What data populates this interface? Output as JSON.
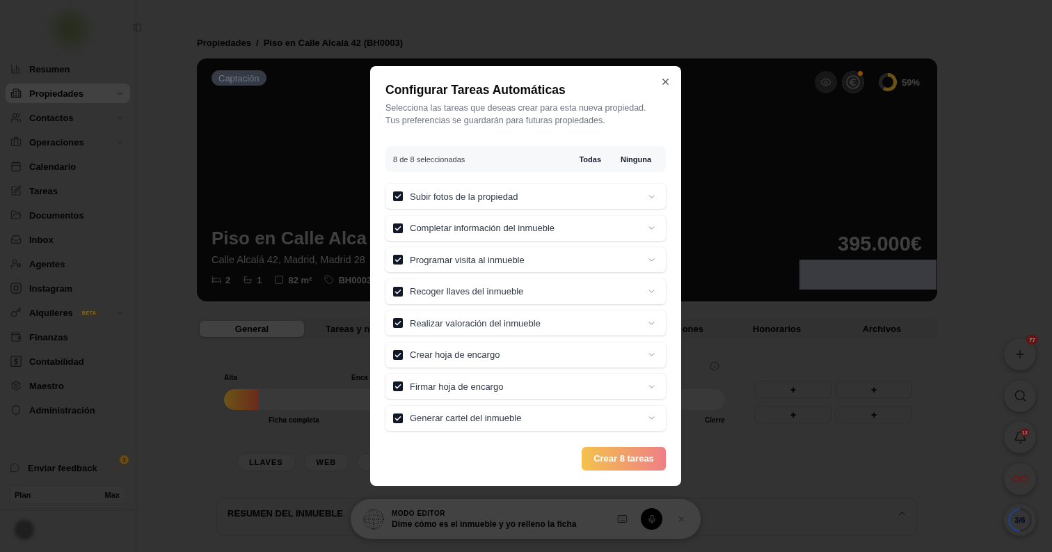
{
  "sidebar": {
    "items": [
      {
        "label": "Resumen",
        "kind": "link",
        "selected": false
      },
      {
        "label": "Propiedades",
        "kind": "group",
        "selected": true
      },
      {
        "label": "Contactos",
        "kind": "group",
        "selected": false
      },
      {
        "label": "Operaciones",
        "kind": "group",
        "selected": false
      },
      {
        "label": "Calendario",
        "kind": "link",
        "selected": false
      },
      {
        "label": "Tareas",
        "kind": "link",
        "selected": false
      },
      {
        "label": "Documentos",
        "kind": "link",
        "selected": false
      },
      {
        "label": "Inbox",
        "kind": "link",
        "selected": false
      },
      {
        "label": "Agentes",
        "kind": "link",
        "selected": false
      },
      {
        "label": "Instagram",
        "kind": "link",
        "selected": false
      },
      {
        "label": "Alquileres",
        "kind": "group",
        "badge": "BETA",
        "selected": false
      },
      {
        "label": "Finanzas",
        "kind": "link",
        "selected": false
      },
      {
        "label": "Contabilidad",
        "kind": "link",
        "selected": false
      },
      {
        "label": "Maestro",
        "kind": "link",
        "selected": false
      },
      {
        "label": "Administración",
        "kind": "link",
        "selected": false
      }
    ],
    "feedback": {
      "label": "Enviar feedback",
      "alert_count": "1"
    },
    "plan": {
      "label": "Plan",
      "value": "Max"
    }
  },
  "breadcrumb": {
    "items": [
      "Propiedades",
      "Piso en Calle Alcalá 42 (BH0003)"
    ],
    "separator": "/"
  },
  "property": {
    "status": "Captación",
    "billing_notification": true,
    "completion": {
      "level": 0.59,
      "reading": "59%"
    },
    "title": "Piso en Calle Alca",
    "address": "Calle Alcalá 42, Madrid, Madrid 28",
    "features": [
      {
        "kind": "bedrooms",
        "value": "2"
      },
      {
        "kind": "bathrooms",
        "value": "1"
      },
      {
        "kind": "area",
        "value": "82 m²"
      },
      {
        "kind": "reference",
        "value": "BH0003"
      }
    ],
    "price": "395.000€"
  },
  "tabs": [
    {
      "label": "General",
      "selected": true
    },
    {
      "label": "Tareas y n",
      "selected": false
    },
    {
      "label": "ones",
      "selected": false
    },
    {
      "label": "Honorarios",
      "selected": false
    },
    {
      "label": "Archivos",
      "selected": false
    }
  ],
  "pipeline": {
    "top_labels": [
      "Alta",
      "Enca"
    ],
    "bottom_labels": [
      "Ficha completa",
      "Cierre"
    ],
    "level": 0.07,
    "add_buttons": [
      "+",
      "+",
      "+",
      "+"
    ]
  },
  "quick_links": [
    {
      "kind": "text",
      "label": "LLAVES"
    },
    {
      "kind": "text",
      "label": "WEB"
    },
    {
      "kind": "icon"
    }
  ],
  "summary": {
    "title": "RESUMEN DEL INMUEBLE",
    "expanded": true
  },
  "editor_bar": {
    "title": "MODO EDITOR",
    "prompt": "Dime cómo es el inmueble y yo relleno la ficha"
  },
  "floating_actions": [
    {
      "kind": "add",
      "badge": "77"
    },
    {
      "kind": "search"
    },
    {
      "kind": "notifications",
      "badge": "12"
    },
    {
      "kind": "infinity"
    },
    {
      "kind": "progress",
      "reading": "3/6",
      "level": 0.5
    }
  ],
  "dialog": {
    "title": "Configurar Tareas Automáticas",
    "description": [
      "Selecciona las tareas que deseas crear para esta nueva propiedad.",
      "Tus preferencias se guardarán para futuras propiedades."
    ],
    "selection_count": "8 de 8 seleccionadas",
    "select_all": "Todas",
    "select_none": "Ninguna",
    "tasks": [
      {
        "label": "Subir fotos de la propiedad",
        "checked": true,
        "expanded": false
      },
      {
        "label": "Completar información del inmueble",
        "checked": true,
        "expanded": false
      },
      {
        "label": "Programar visita al inmueble",
        "checked": true,
        "expanded": false
      },
      {
        "label": "Recoger llaves del inmueble",
        "checked": true,
        "expanded": false
      },
      {
        "label": "Realizar valoración del inmueble",
        "checked": true,
        "expanded": false
      },
      {
        "label": "Crear hoja de encargo",
        "checked": true,
        "expanded": false
      },
      {
        "label": "Firmar hoja de encargo",
        "checked": true,
        "expanded": false
      },
      {
        "label": "Generar cartel del inmueble",
        "checked": true,
        "expanded": false
      }
    ],
    "submit": "Crear 8 tareas"
  }
}
